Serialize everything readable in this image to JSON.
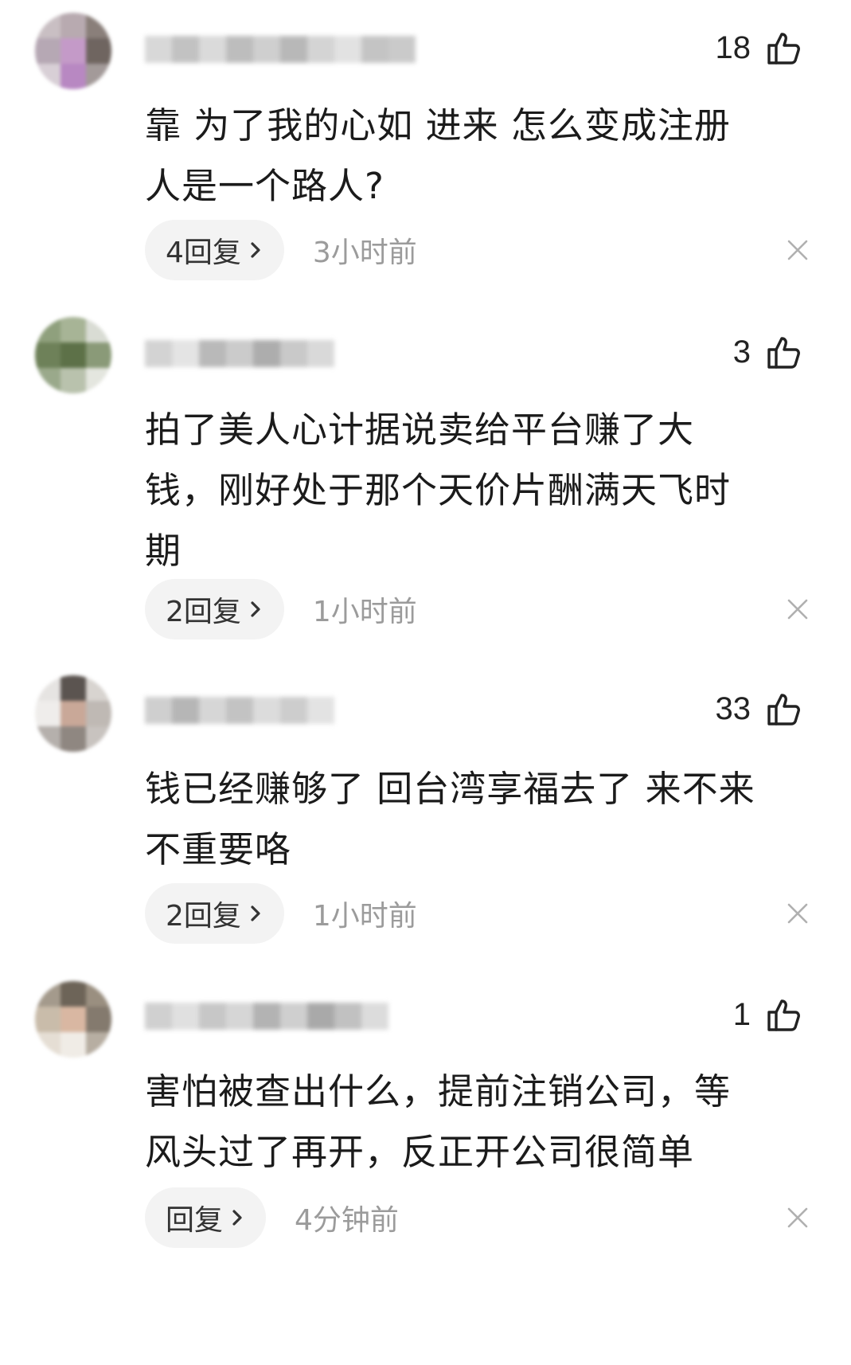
{
  "comments": [
    {
      "likes": "18",
      "text_lines": [
        "靠 为了我的心如 进来 怎么变成注册",
        "人是一个路人?"
      ],
      "replies_label": "4回复",
      "time": "3小时前"
    },
    {
      "likes": "3",
      "text_lines": [
        "拍了美人心计据说卖给平台赚了大",
        "钱，刚好处于那个天价片酬满天飞时",
        "期"
      ],
      "replies_label": "2回复",
      "time": "1小时前"
    },
    {
      "likes": "33",
      "text_lines": [
        "钱已经赚够了 回台湾享福去了 来不来",
        "不重要咯"
      ],
      "replies_label": "2回复",
      "time": "1小时前"
    },
    {
      "likes": "1",
      "text_lines": [
        "害怕被查出什么，提前注销公司，等",
        "风头过了再开，反正开公司很简单"
      ],
      "replies_label": "回复",
      "time": "4分钟前"
    }
  ],
  "icons": {
    "like": "thumbs-up-icon",
    "reply_chevron": "chevron-right-icon",
    "dismiss": "close-icon"
  },
  "colors": {
    "text": "#1b1b1b",
    "meta": "#9b9b9b",
    "pill_bg": "#f3f3f3"
  }
}
